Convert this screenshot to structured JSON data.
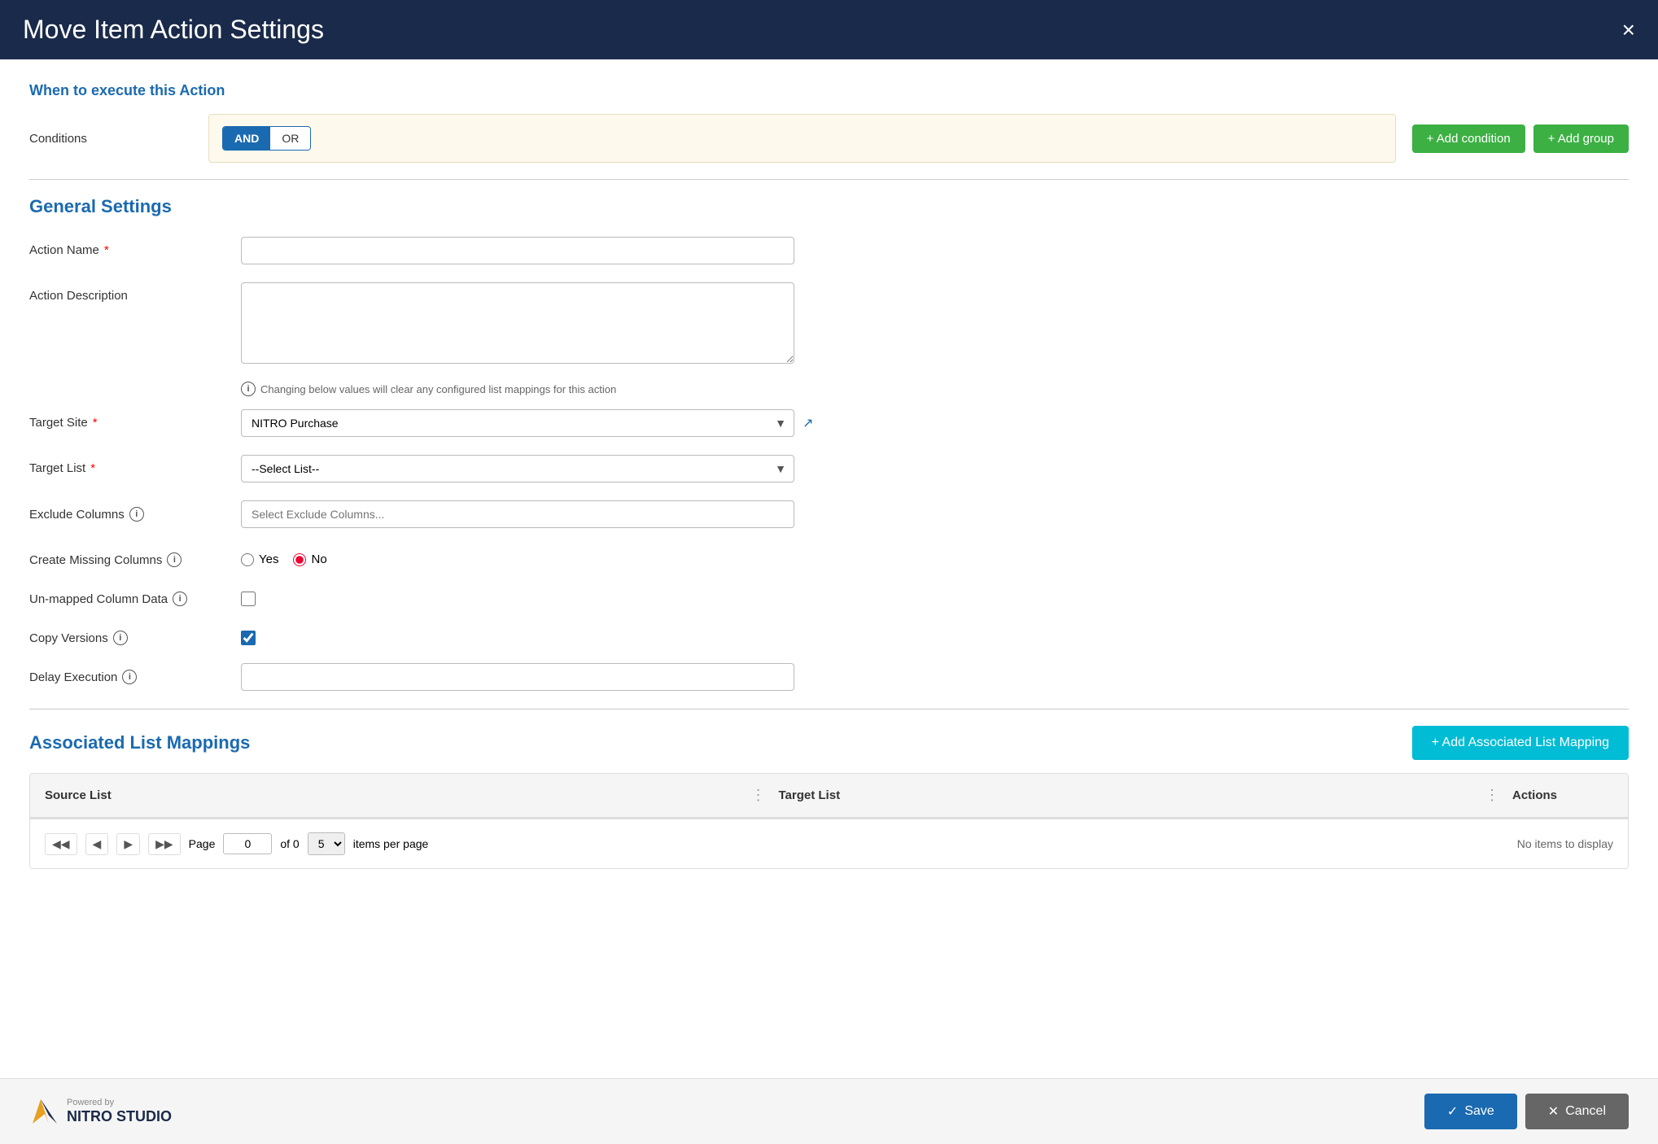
{
  "header": {
    "title": "Move Item Action Settings",
    "close_label": "×"
  },
  "when_section": {
    "label": "When to execute this Action"
  },
  "conditions": {
    "label": "Conditions",
    "and_label": "AND",
    "or_label": "OR",
    "add_condition_label": "+ Add condition",
    "add_group_label": "+ Add group"
  },
  "general_settings": {
    "title": "General Settings",
    "action_name_label": "Action Name",
    "action_name_placeholder": "",
    "action_description_label": "Action Description",
    "action_description_placeholder": "",
    "warning_text": "Changing below values will clear any configured list mappings for this action",
    "target_site_label": "Target Site",
    "target_site_value": "NITRO Purchase",
    "target_list_label": "Target List",
    "target_list_value": "--Select List--",
    "exclude_columns_label": "Exclude Columns",
    "exclude_columns_placeholder": "Select Exclude Columns...",
    "create_missing_columns_label": "Create Missing Columns",
    "create_missing_yes": "Yes",
    "create_missing_no": "No",
    "unmapped_column_label": "Un-mapped Column Data",
    "copy_versions_label": "Copy Versions",
    "delay_execution_label": "Delay Execution",
    "delay_execution_placeholder": ""
  },
  "associated_list": {
    "title": "Associated List Mappings",
    "add_mapping_label": "+ Add Associated List Mapping",
    "source_list_header": "Source List",
    "target_list_header": "Target List",
    "actions_header": "Actions",
    "page_label": "Page",
    "of_label": "of 0",
    "page_value": "0",
    "items_per_page_label": "items per page",
    "items_per_page_value": "5",
    "no_items_text": "No items to display"
  },
  "footer": {
    "powered_by": "Powered by",
    "brand": "NITRO STUDIO",
    "save_label": "Save",
    "cancel_label": "Cancel"
  },
  "colors": {
    "header_bg": "#1a2a4a",
    "accent_blue": "#1a6ab1",
    "add_green": "#3cb043",
    "add_teal": "#00bcd4"
  }
}
